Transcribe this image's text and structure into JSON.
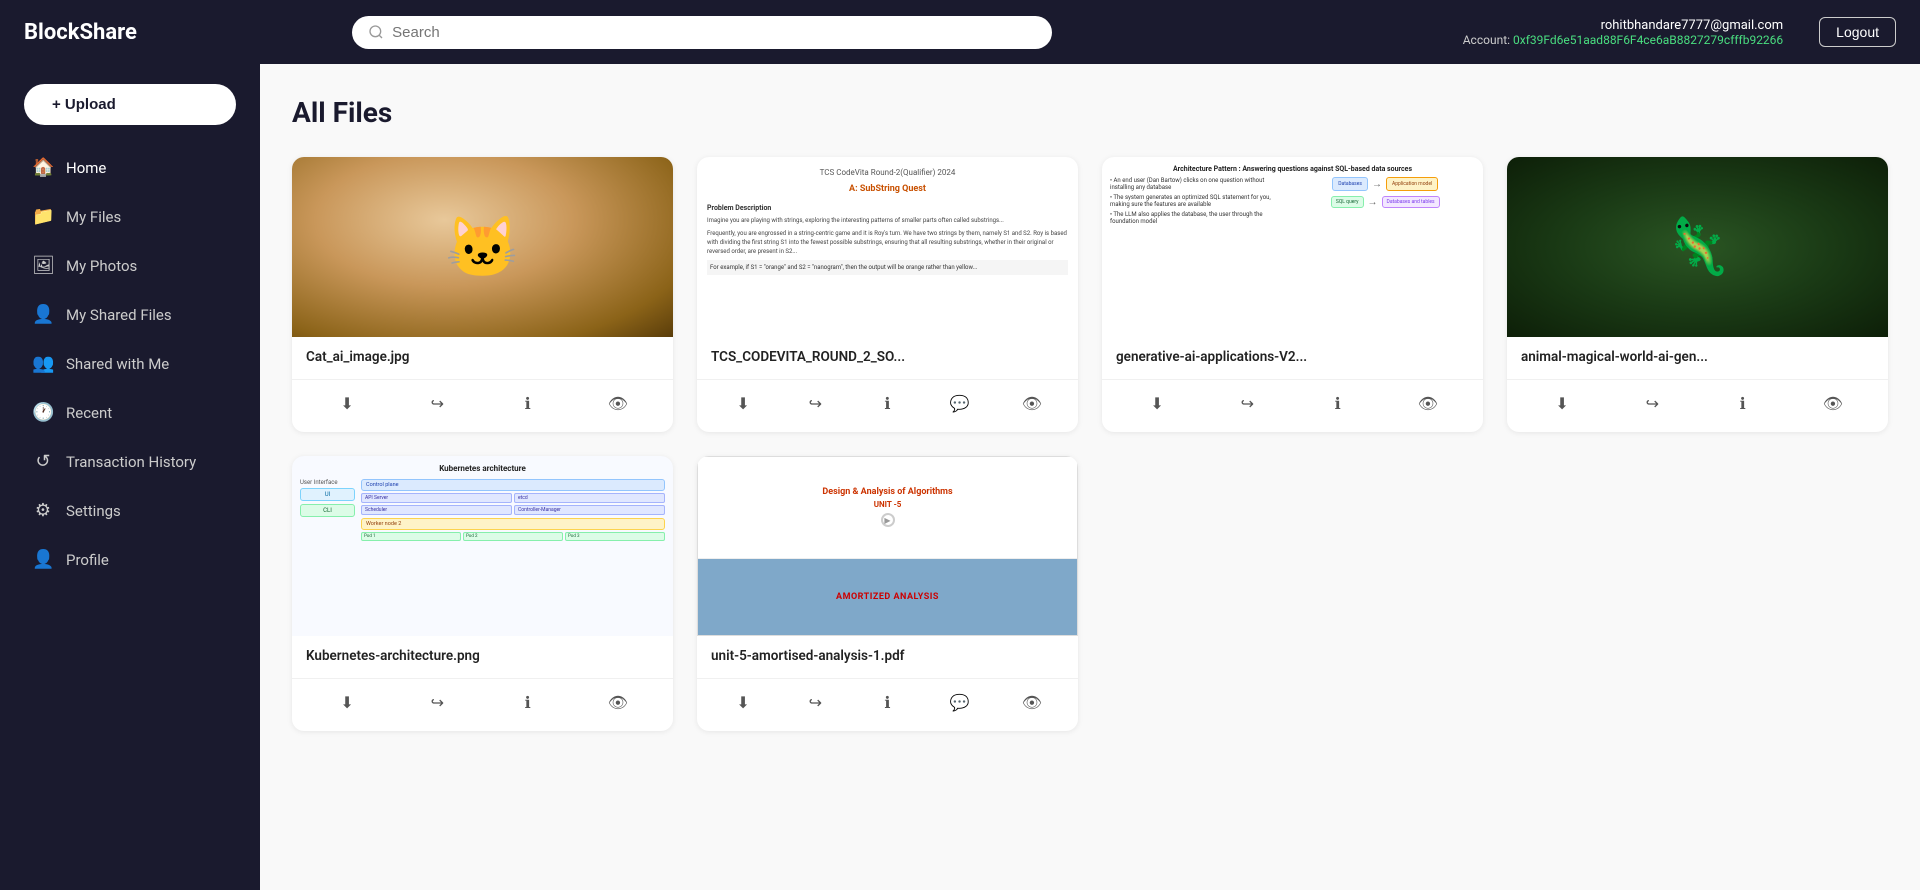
{
  "app": {
    "name": "BlockShare"
  },
  "topnav": {
    "logo": "BlockShare",
    "search_placeholder": "Search",
    "user_email": "rohitbhandare7777@gmail.com",
    "account_label": "Account:",
    "account_address": "0xf39Fd6e51aad88F6F4ce6aB8827279cfffb92266",
    "logout_label": "Logout"
  },
  "sidebar": {
    "upload_label": "+ Upload",
    "items": [
      {
        "id": "home",
        "label": "Home",
        "icon": "🏠"
      },
      {
        "id": "my-files",
        "label": "My Files",
        "icon": "📁"
      },
      {
        "id": "my-photos",
        "label": "My Photos",
        "icon": "🖼"
      },
      {
        "id": "my-shared-files",
        "label": "My Shared Files",
        "icon": "👤"
      },
      {
        "id": "shared-with-me",
        "label": "Shared with Me",
        "icon": "👥"
      },
      {
        "id": "recent",
        "label": "Recent",
        "icon": "🕐"
      },
      {
        "id": "transaction-history",
        "label": "Transaction History",
        "icon": "↺"
      },
      {
        "id": "settings",
        "label": "Settings",
        "icon": "⚙"
      },
      {
        "id": "profile",
        "label": "Profile",
        "icon": "👤"
      }
    ]
  },
  "main": {
    "page_title": "All Files",
    "files": [
      {
        "id": "cat",
        "name": "Cat_ai_image.jpg",
        "type": "image",
        "thumb_type": "cat"
      },
      {
        "id": "tcs",
        "name": "TCS_CODEVITA_ROUND_2_SO...",
        "type": "pdf",
        "thumb_type": "tcs"
      },
      {
        "id": "arch",
        "name": "generative-ai-applications-V2...",
        "type": "image",
        "thumb_type": "arch"
      },
      {
        "id": "animal",
        "name": "animal-magical-world-ai-gen...",
        "type": "image",
        "thumb_type": "animal"
      },
      {
        "id": "k8s",
        "name": "Kubernetes-architecture.png",
        "type": "image",
        "thumb_type": "k8s"
      },
      {
        "id": "algo",
        "name": "unit-5-amortised-analysis-1.pdf",
        "type": "pdf",
        "thumb_type": "algo"
      }
    ],
    "action_icons": {
      "download": "⬇",
      "share": "↪",
      "info": "ℹ",
      "comment": "💬",
      "view": "👁"
    }
  }
}
